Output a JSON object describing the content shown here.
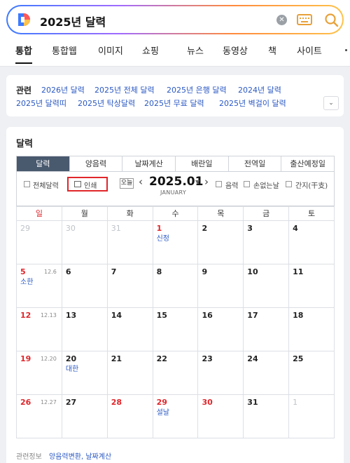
{
  "search": {
    "query": "2025년 달력",
    "clear_icon": "clear-icon",
    "keyboard_icon": "keyboard-icon",
    "search_icon": "search-icon",
    "logo": "daum-logo"
  },
  "tabs": [
    "통합",
    "통합웹",
    "이미지",
    "쇼핑",
    "뉴스",
    "동영상",
    "책",
    "사이트"
  ],
  "related": {
    "label": "관련",
    "links": [
      "2026년 달력",
      "2025년 전체 달력",
      "2025년 은행 달력",
      "2024년 달력",
      "2025년 달력띠",
      "2025년 탁상달력",
      "2025년 무료 달력",
      "2025년 벽걸이 달력"
    ]
  },
  "calendar": {
    "title": "달력",
    "subtabs": [
      "달력",
      "양음력",
      "날짜계산",
      "배란일",
      "전역일",
      "출산예정일"
    ],
    "controls": {
      "full_calendar": "전체달력",
      "print": "인쇄",
      "today": "오늘",
      "month": "2025.01",
      "month_en": "JANUARY",
      "lunar": "음력",
      "no_loss_day": "손없는날",
      "ganji": "간지(干支)"
    },
    "weekdays": [
      "일",
      "월",
      "화",
      "수",
      "목",
      "금",
      "토"
    ],
    "weeks": [
      [
        {
          "d": "29",
          "o": true
        },
        {
          "d": "30",
          "o": true
        },
        {
          "d": "31",
          "o": true
        },
        {
          "d": "1",
          "r": true,
          "e": "신정"
        },
        {
          "d": "2"
        },
        {
          "d": "3"
        },
        {
          "d": "4"
        }
      ],
      [
        {
          "d": "5",
          "r": true,
          "l": "12.6",
          "e": "소한"
        },
        {
          "d": "6"
        },
        {
          "d": "7"
        },
        {
          "d": "8"
        },
        {
          "d": "9"
        },
        {
          "d": "10"
        },
        {
          "d": "11"
        }
      ],
      [
        {
          "d": "12",
          "r": true,
          "l": "12.13"
        },
        {
          "d": "13"
        },
        {
          "d": "14"
        },
        {
          "d": "15"
        },
        {
          "d": "16"
        },
        {
          "d": "17"
        },
        {
          "d": "18"
        }
      ],
      [
        {
          "d": "19",
          "r": true,
          "l": "12.20"
        },
        {
          "d": "20",
          "e": "대한"
        },
        {
          "d": "21"
        },
        {
          "d": "22"
        },
        {
          "d": "23"
        },
        {
          "d": "24"
        },
        {
          "d": "25"
        }
      ],
      [
        {
          "d": "26",
          "r": true,
          "l": "12.27"
        },
        {
          "d": "27"
        },
        {
          "d": "28",
          "r": true
        },
        {
          "d": "29",
          "r": true,
          "e": "설날"
        },
        {
          "d": "30",
          "r": true
        },
        {
          "d": "31"
        },
        {
          "d": "1",
          "o": true
        }
      ]
    ],
    "related_info_label": "관련정보",
    "related_info_links": "양음력변환, 날짜계산"
  },
  "colors": {
    "accent_blue": "#2b59c3",
    "holiday_red": "#e0262b",
    "active_tab": "#49596e"
  }
}
